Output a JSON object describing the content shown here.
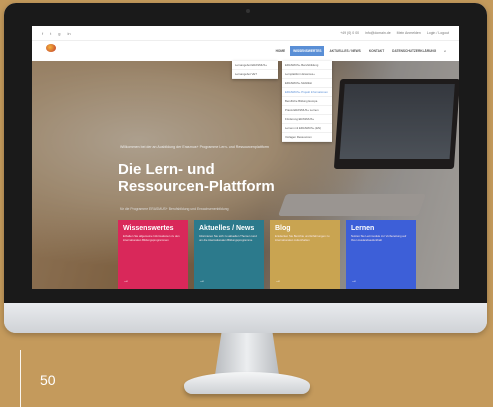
{
  "topbar": {
    "social_icons": [
      "f",
      "t",
      "g",
      "in"
    ],
    "info": [
      "+49 (0) 0 00",
      "info@domain.de",
      "Mein Anmelden",
      "Login / Logout"
    ]
  },
  "nav": {
    "logo_text": "logo",
    "items": [
      "Home",
      "Wissenswertes",
      "Aktuelles / News",
      "Kontakt",
      "Datenschutzerklärung"
    ],
    "active_index": 1
  },
  "dropdown1": [
    "Lernangebot ERASMUS+",
    "Lernangebot VET"
  ],
  "dropdown2": [
    "ERASMUS+ Berufsbildung",
    "Lernplattform Erasmus+",
    "ERASMUS+ Mobilität",
    "ERASMUS+ Projekt Informationen",
    "Berufliche Bildung Europa",
    "Praxis ERASMUS+ Lernen",
    "Förderung ERASMUS+",
    "Lernen mit ERASMUS+ (EN)",
    "Vorlagen Ressourcen"
  ],
  "hero": {
    "welcome": "Willkommen bei der an Ausbildung der Erasmus+ Programme Lern- und Ressourcenplattform",
    "title_line1": "Die Lern- und",
    "title_line2": "Ressourcen-Plattform",
    "subtitle": "für die Programme ERASMUS+ Berufsbildung und Erwachsenenbildung"
  },
  "cards": [
    {
      "title": "Wissenswertes",
      "text": "Erhalten Sie allgemeine Informationen zu den internationalen Bildungsprogrammen",
      "color": "#d9285a"
    },
    {
      "title": "Aktuelles / News",
      "text": "Informieren Sie sich zu aktuellen Themen rund um die internationalen Bildungsprogramme",
      "color": "#2c7a8c"
    },
    {
      "title": "Blog",
      "text": "Entdecken Sie Berichte und Erfahrungen zu internationalen Aufenthalten",
      "color": "#c9a451"
    },
    {
      "title": "Lernen",
      "text": "Nutzen Sie Lernmodule zur Vorbereitung auf Ihren Auslandsaufenthalt",
      "color": "#3d5fd8"
    }
  ],
  "page_number": "50"
}
